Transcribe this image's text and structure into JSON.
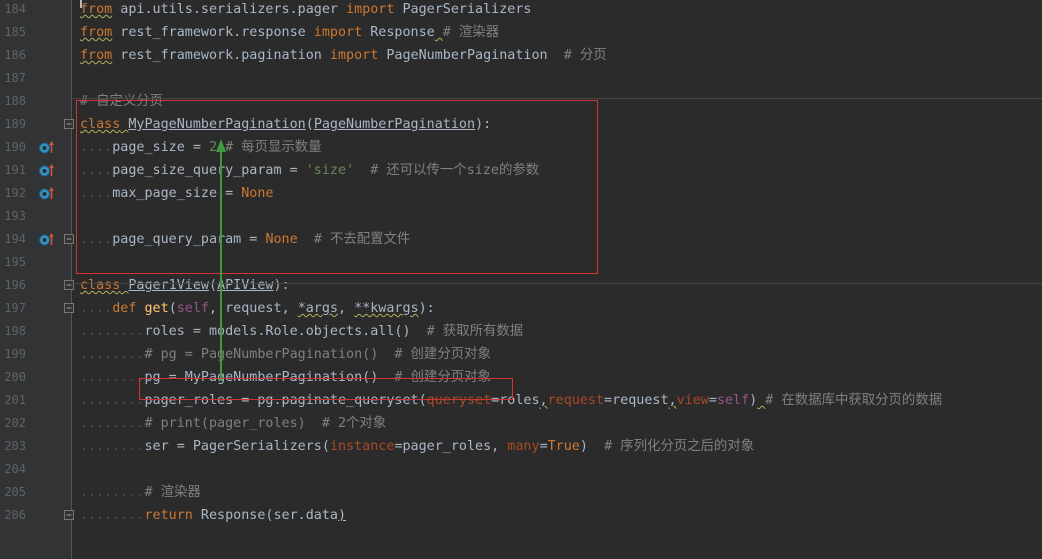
{
  "editor": {
    "lines": [
      {
        "n": "184",
        "segments": [
          {
            "t": "from",
            "c": "kw wavy"
          },
          {
            "t": " api.utils.serializers.pager ",
            "c": ""
          },
          {
            "t": "import",
            "c": "kw"
          },
          {
            "t": " PagerSerializers",
            "c": ""
          }
        ]
      },
      {
        "n": "185",
        "segments": [
          {
            "t": "from",
            "c": "kw wavy"
          },
          {
            "t": " rest_framework.response ",
            "c": ""
          },
          {
            "t": "import",
            "c": "kw"
          },
          {
            "t": " Response",
            "c": ""
          },
          {
            "t": " ",
            "c": "wavy"
          },
          {
            "t": "# 渲染器",
            "c": "cm"
          }
        ]
      },
      {
        "n": "186",
        "segments": [
          {
            "t": "from",
            "c": "kw wavy"
          },
          {
            "t": " rest_framework.pagination ",
            "c": ""
          },
          {
            "t": "import",
            "c": "kw"
          },
          {
            "t": " PageNumberPagination  ",
            "c": ""
          },
          {
            "t": "# 分页",
            "c": "cm"
          }
        ]
      },
      {
        "n": "187",
        "segments": []
      },
      {
        "n": "188",
        "segments": [
          {
            "t": "# 自定义分页",
            "c": "cm"
          }
        ]
      },
      {
        "n": "189",
        "segments": [
          {
            "t": "class",
            "c": "kw wavy"
          },
          {
            "t": " ",
            "c": "wavy"
          },
          {
            "t": "MyPageNumberPagination",
            "c": "ul"
          },
          {
            "t": "(",
            "c": ""
          },
          {
            "t": "PageNumberPagination",
            "c": "ul"
          },
          {
            "t": "):",
            "c": ""
          }
        ]
      },
      {
        "n": "190",
        "segments": [
          {
            "t": "    ",
            "c": "dots"
          },
          {
            "t": "page_size = ",
            "c": ""
          },
          {
            "t": "2",
            "c": "str"
          },
          {
            "t": " ",
            "c": ""
          },
          {
            "t": "# 每页显示数量",
            "c": "cm"
          }
        ]
      },
      {
        "n": "191",
        "segments": [
          {
            "t": "    ",
            "c": "dots"
          },
          {
            "t": "page_size_query_param = ",
            "c": ""
          },
          {
            "t": "'size'",
            "c": "str"
          },
          {
            "t": "  ",
            "c": ""
          },
          {
            "t": "# 还可以传一个size的参数",
            "c": "cm"
          }
        ]
      },
      {
        "n": "192",
        "segments": [
          {
            "t": "    ",
            "c": "dots"
          },
          {
            "t": "max_page_size = ",
            "c": ""
          },
          {
            "t": "None",
            "c": "kw"
          }
        ]
      },
      {
        "n": "193",
        "segments": []
      },
      {
        "n": "194",
        "segments": [
          {
            "t": "    ",
            "c": "dots"
          },
          {
            "t": "page_query_param = ",
            "c": ""
          },
          {
            "t": "None",
            "c": "kw"
          },
          {
            "t": "  ",
            "c": ""
          },
          {
            "t": "# 不去配置文件",
            "c": "cm"
          }
        ]
      },
      {
        "n": "195",
        "segments": []
      },
      {
        "n": "196",
        "segments": [
          {
            "t": "class",
            "c": "kw wavy"
          },
          {
            "t": " ",
            "c": "wavy"
          },
          {
            "t": "Pager1View",
            "c": "ul"
          },
          {
            "t": "(",
            "c": ""
          },
          {
            "t": "APIView",
            "c": "ul"
          },
          {
            "t": "):",
            "c": ""
          }
        ]
      },
      {
        "n": "197",
        "segments": [
          {
            "t": "    ",
            "c": "dots"
          },
          {
            "t": "def",
            "c": "kw"
          },
          {
            "t": " ",
            "c": ""
          },
          {
            "t": "get",
            "c": "fn"
          },
          {
            "t": "(",
            "c": ""
          },
          {
            "t": "self",
            "c": "pm"
          },
          {
            "t": ", ",
            "c": ""
          },
          {
            "t": "request",
            "c": ""
          },
          {
            "t": ", ",
            "c": ""
          },
          {
            "t": "*args",
            "c": "wavy"
          },
          {
            "t": ", ",
            "c": ""
          },
          {
            "t": "**kwargs",
            "c": "wavy"
          },
          {
            "t": "):",
            "c": ""
          }
        ]
      },
      {
        "n": "198",
        "segments": [
          {
            "t": "        ",
            "c": "dots"
          },
          {
            "t": "roles = models.Role.objects.all()  ",
            "c": ""
          },
          {
            "t": "# 获取所有数据",
            "c": "cm"
          }
        ]
      },
      {
        "n": "199",
        "segments": [
          {
            "t": "        ",
            "c": "dots"
          },
          {
            "t": "# pg = PageNumberPagination()  # 创建分页对象",
            "c": "cm"
          }
        ]
      },
      {
        "n": "200",
        "segments": [
          {
            "t": "        ",
            "c": "dots"
          },
          {
            "t": "pg = MyPageNumberPagination()  ",
            "c": ""
          },
          {
            "t": "# 创建分页对象",
            "c": "cm"
          }
        ]
      },
      {
        "n": "201",
        "segments": [
          {
            "t": "        ",
            "c": "dots"
          },
          {
            "t": "pager_roles = pg.paginate_queryset(",
            "c": ""
          },
          {
            "t": "queryset",
            "c": "kwa"
          },
          {
            "t": "=roles",
            "c": ""
          },
          {
            "t": ",",
            "c": "wavy"
          },
          {
            "t": "request",
            "c": "kwa"
          },
          {
            "t": "=request",
            "c": ""
          },
          {
            "t": ",",
            "c": "wavy"
          },
          {
            "t": "view",
            "c": "kwa"
          },
          {
            "t": "=",
            "c": ""
          },
          {
            "t": "self",
            "c": "pm"
          },
          {
            "t": ")",
            "c": ""
          },
          {
            "t": " ",
            "c": "wavy"
          },
          {
            "t": "# 在数据库中获取分页的数据",
            "c": "cm"
          }
        ]
      },
      {
        "n": "202",
        "segments": [
          {
            "t": "        ",
            "c": "dots"
          },
          {
            "t": "# print(pager_roles)  # 2个对象",
            "c": "cm"
          }
        ]
      },
      {
        "n": "203",
        "segments": [
          {
            "t": "        ",
            "c": "dots"
          },
          {
            "t": "ser = PagerSerializers(",
            "c": ""
          },
          {
            "t": "instance",
            "c": "kwa"
          },
          {
            "t": "=pager_roles, ",
            "c": ""
          },
          {
            "t": "many",
            "c": "kwa"
          },
          {
            "t": "=",
            "c": ""
          },
          {
            "t": "True",
            "c": "kw"
          },
          {
            "t": ")  ",
            "c": ""
          },
          {
            "t": "# 序列化分页之后的对象",
            "c": "cm"
          }
        ]
      },
      {
        "n": "204",
        "segments": []
      },
      {
        "n": "205",
        "segments": [
          {
            "t": "        ",
            "c": "dots"
          },
          {
            "t": "# 渲染器",
            "c": "cm"
          }
        ]
      },
      {
        "n": "206",
        "segments": [
          {
            "t": "        ",
            "c": "dots"
          },
          {
            "t": "return",
            "c": "kw"
          },
          {
            "t": " Response(ser.data",
            "c": ""
          },
          {
            "t": ")",
            "c": "ul"
          }
        ]
      }
    ],
    "colors": {
      "background": "#2b2b2b",
      "gutter": "#313335",
      "keyword": "#cc7832",
      "comment": "#808080",
      "string": "#6a8759",
      "function": "#ffc66d",
      "self": "#94558d",
      "kwarg": "#aa4926",
      "text": "#a9b7c6",
      "annotation_box": "#d03434",
      "annotation_arrow": "#3d9a3d"
    },
    "icons": {
      "override_marker": "override-up-arrow-icon",
      "fold_marker": "fold-icon"
    }
  }
}
